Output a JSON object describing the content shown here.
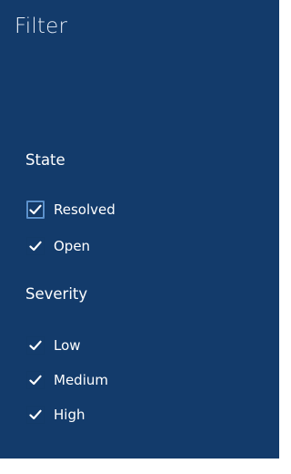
{
  "panel": {
    "title": "Filter",
    "background": "#133b6b"
  },
  "sections": [
    {
      "title": "State",
      "items": [
        {
          "label": "Resolved",
          "checked": true,
          "focused": true
        },
        {
          "label": "Open",
          "checked": true,
          "focused": false
        }
      ]
    },
    {
      "title": "Severity",
      "items": [
        {
          "label": "Low",
          "checked": true,
          "focused": false
        },
        {
          "label": "Medium",
          "checked": true,
          "focused": false
        },
        {
          "label": "High",
          "checked": true,
          "focused": false
        }
      ]
    }
  ],
  "icons": {
    "check": "checkmark-icon"
  }
}
